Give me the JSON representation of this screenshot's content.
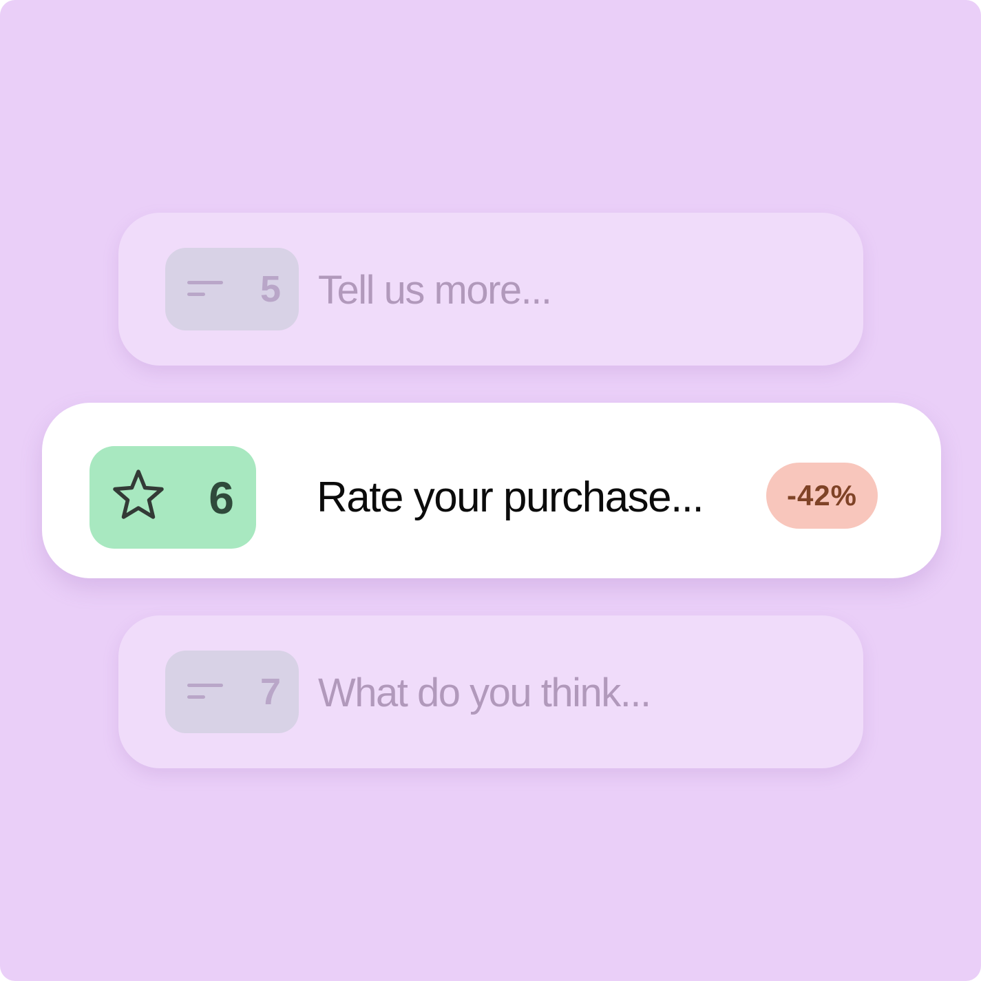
{
  "questions": [
    {
      "number": "5",
      "text": "Tell us more...",
      "icon": "short-text-icon",
      "state": "inactive"
    },
    {
      "number": "6",
      "text": "Rate your purchase...",
      "icon": "star-icon",
      "state": "active",
      "badge": "-42%"
    },
    {
      "number": "7",
      "text": "What do you think...",
      "icon": "short-text-icon",
      "state": "inactive"
    }
  ],
  "colors": {
    "background": "#eacff8",
    "faded_card": "#f0dcfa",
    "active_card": "#ffffff",
    "active_chip": "#a8e8c0",
    "badge_bg": "#f8c6bc",
    "badge_text": "#7f4327"
  }
}
